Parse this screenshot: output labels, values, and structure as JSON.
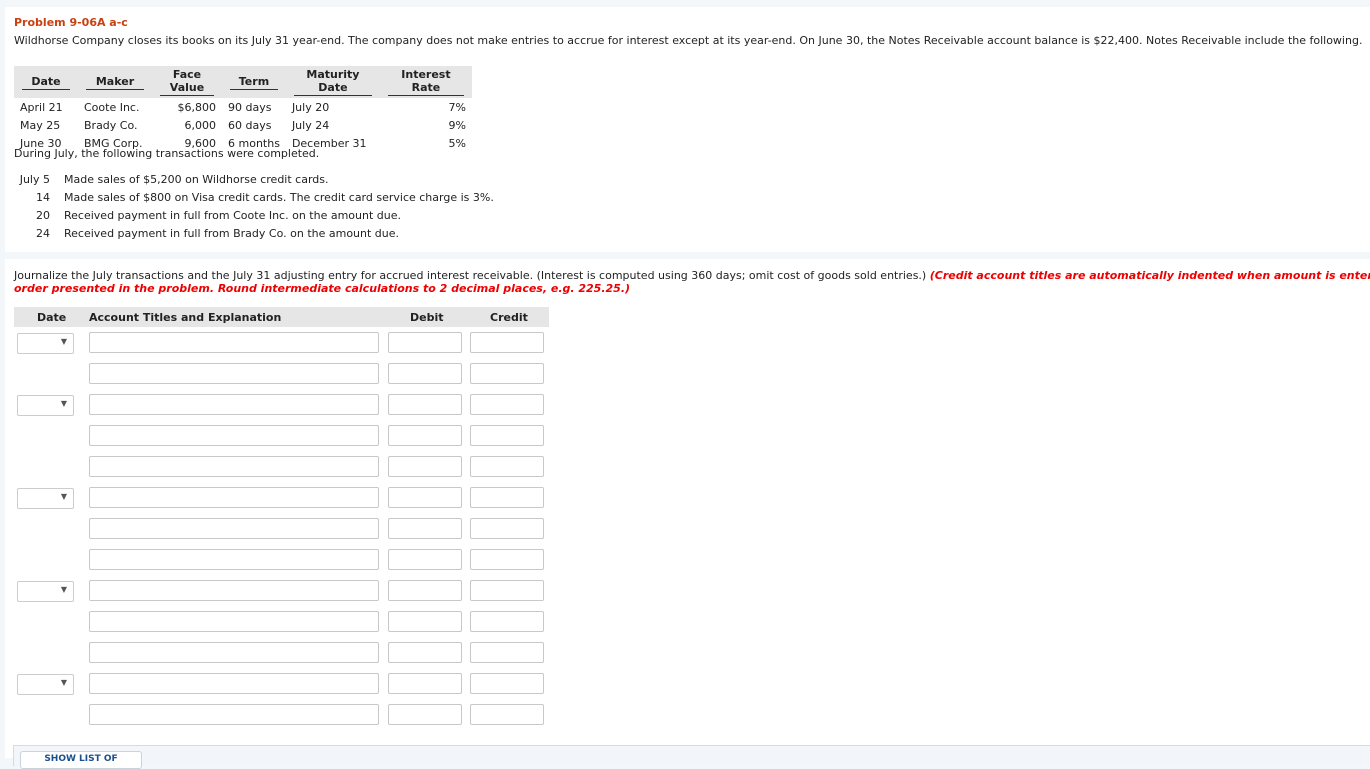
{
  "problem": {
    "title": "Problem 9-06A a-c",
    "intro": "Wildhorse Company closes its books on its July 31 year-end. The company does not make entries to accrue for interest except at its year-end. On June 30, the Notes Receivable account balance is $22,400. Notes Receivable include the following."
  },
  "notes_table": {
    "headers": [
      "Date",
      "Maker",
      "Face Value",
      "Term",
      "Maturity Date",
      "Interest Rate"
    ],
    "rows": [
      [
        "April 21",
        "Coote Inc.",
        "$6,800",
        "90 days",
        "July 20",
        "7%"
      ],
      [
        "May 25",
        "Brady Co.",
        "6,000",
        "60 days",
        "July 24",
        "9%"
      ],
      [
        "June 30",
        "BMG Corp.",
        "9,600",
        "6 months",
        "December 31",
        "5%"
      ]
    ]
  },
  "transactions": {
    "intro": "During July, the following transactions were completed.",
    "items": [
      {
        "day": "July 5",
        "text": "Made sales of $5,200 on Wildhorse credit cards."
      },
      {
        "day": "14",
        "text": "Made sales of $800 on Visa credit cards. The credit card service charge is 3%."
      },
      {
        "day": "20",
        "text": "Received payment in full from Coote Inc. on the amount due."
      },
      {
        "day": "24",
        "text": "Received payment in full from Brady Co. on the amount due."
      }
    ]
  },
  "instructions": {
    "normal": "Journalize the July transactions and the July 31 adjusting entry for accrued interest receivable. (Interest is computed using 360 days; omit cost of goods sold entries.) ",
    "red_line1": "(Credit account titles are automatically indented when amount is entered. Do not indent manually. Record journal entries in the",
    "red_line2": "order presented in the problem. Round intermediate calculations to 2 decimal places, e.g. 225.25.)"
  },
  "journal": {
    "headers": {
      "date": "Date",
      "account": "Account Titles and Explanation",
      "debit": "Debit",
      "credit": "Credit"
    },
    "rows": [
      {
        "has_date": true,
        "date": "",
        "account": "",
        "debit": "",
        "credit": ""
      },
      {
        "has_date": false,
        "account": "",
        "debit": "",
        "credit": ""
      },
      {
        "has_date": true,
        "date": "",
        "account": "",
        "debit": "",
        "credit": ""
      },
      {
        "has_date": false,
        "account": "",
        "debit": "",
        "credit": ""
      },
      {
        "has_date": false,
        "account": "",
        "debit": "",
        "credit": ""
      },
      {
        "has_date": true,
        "date": "",
        "account": "",
        "debit": "",
        "credit": ""
      },
      {
        "has_date": false,
        "account": "",
        "debit": "",
        "credit": ""
      },
      {
        "has_date": false,
        "account": "",
        "debit": "",
        "credit": ""
      },
      {
        "has_date": true,
        "date": "",
        "account": "",
        "debit": "",
        "credit": ""
      },
      {
        "has_date": false,
        "account": "",
        "debit": "",
        "credit": ""
      },
      {
        "has_date": false,
        "account": "",
        "debit": "",
        "credit": ""
      },
      {
        "has_date": true,
        "date": "",
        "account": "",
        "debit": "",
        "credit": ""
      },
      {
        "has_date": false,
        "account": "",
        "debit": "",
        "credit": ""
      }
    ]
  },
  "footer": {
    "list_button": "SHOW LIST OF ACCOUNTS"
  },
  "colors": {
    "title": "#c8410f",
    "instruction_red": "#ee0000",
    "header_bg": "#e6e6e6"
  }
}
